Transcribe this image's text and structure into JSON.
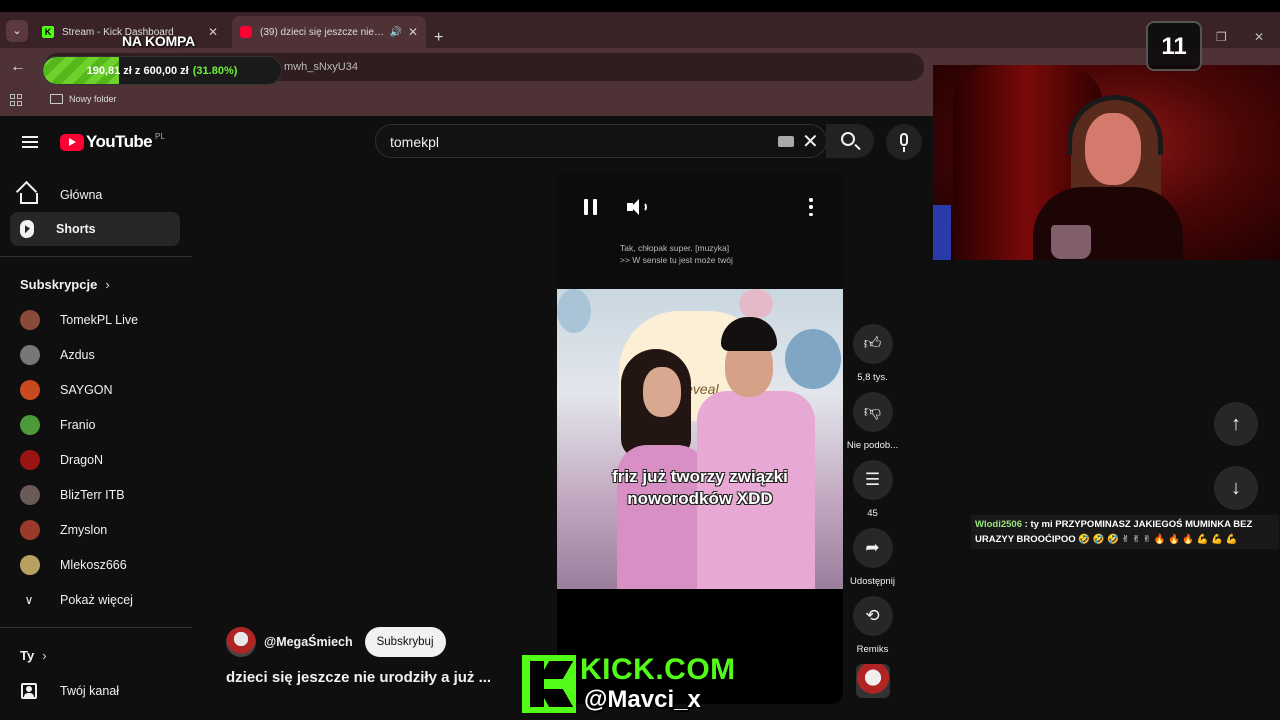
{
  "browser": {
    "tabs": [
      {
        "title": "Stream - Kick Dashboard",
        "favicon": "kick-icon"
      },
      {
        "title": "(39) dzieci się jeszcze nie urodziły a już ...",
        "favicon": "youtube-icon",
        "active": true
      }
    ],
    "url_fragment": "mwh_sNxyU34",
    "bookmarks": [
      {
        "label": "Nowy folder",
        "icon": "folder-icon"
      }
    ]
  },
  "youtube": {
    "logo_text": "YouTube",
    "country": "PL",
    "search": {
      "value": "tomekpl"
    },
    "nav": [
      {
        "label": "Główna",
        "icon": "home-icon"
      },
      {
        "label": "Shorts",
        "icon": "shorts-icon",
        "active": true
      }
    ],
    "subscriptions_title": "Subskrypcje",
    "subscriptions": [
      {
        "label": "TomekPL Live",
        "color": "#8a4a3a"
      },
      {
        "label": "Azdus",
        "color": "#777777"
      },
      {
        "label": "SAYGON",
        "color": "#c84a1e"
      },
      {
        "label": "Franio",
        "color": "#4c9a3a"
      },
      {
        "label": "DragoN",
        "color": "#9a1414"
      },
      {
        "label": "BlizTerr ITB",
        "color": "#6a5a5a"
      },
      {
        "label": "Zmyslon",
        "color": "#9a3a2a"
      },
      {
        "label": "Mlekosz666",
        "color": "#b8a060"
      }
    ],
    "show_more": "Pokaż więcej",
    "you_section": "Ty",
    "your_channel": "Twój kanał",
    "short": {
      "captions": [
        "Tak, chłopak super. [muzyka]",
        ">> W sensie tu jest może twój"
      ],
      "overlay_text": [
        "friz już tworzy związki",
        "noworodków XDD"
      ],
      "neon_sign": "Reveal",
      "channel": "@MegaŚmiech",
      "subscribe_label": "Subskrybuj",
      "title": "dzieci się jeszcze nie urodziły a już ..."
    },
    "actions": [
      {
        "label": "5,8 tys.",
        "icon": "like-icon"
      },
      {
        "label": "Nie podob...",
        "icon": "dislike-icon"
      },
      {
        "label": "45",
        "icon": "comment-icon"
      },
      {
        "label": "Udostępnij",
        "icon": "share-icon"
      },
      {
        "label": "Remiks",
        "icon": "remix-icon"
      }
    ]
  },
  "stream_overlay": {
    "goal_title": "NA KOMPA",
    "goal_text": "190,81 zł z 600,00 zł",
    "goal_percent": "(31.80%)",
    "goal_progress": 0.318,
    "counter": "11",
    "chat": {
      "user": "Wlodi2506",
      "message": ": ty mi PRZYPOMINASZ JAKIEGOŚ MUMINKA BEZ URAZYY BROOĆIPOO 🤣 🤣 🤣 ✌ ✌ ✌ 🔥 🔥 🔥 💪 💪 💪"
    },
    "kick_site": "KICK.COM",
    "kick_user": "@Mavci_x"
  }
}
